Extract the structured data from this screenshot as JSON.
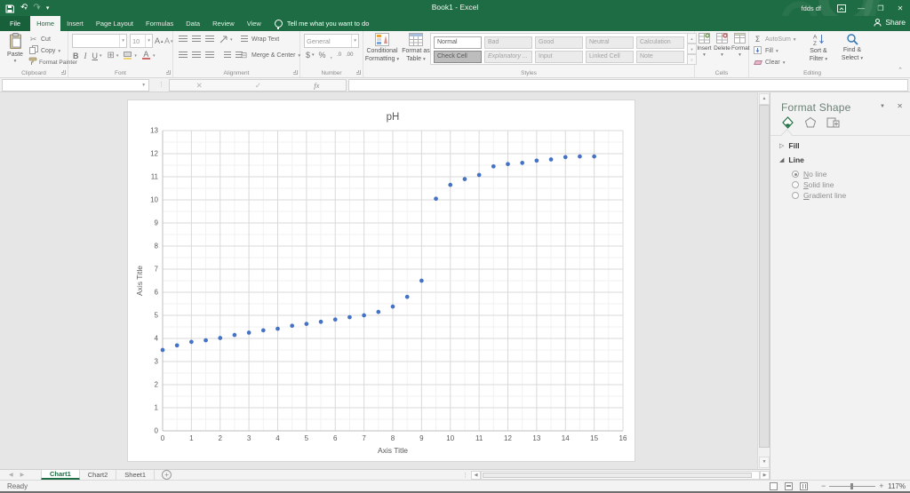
{
  "titlebar": {
    "title": "Book1 - Excel",
    "user": "fdds df"
  },
  "ribbon_tabs": [
    "File",
    "Home",
    "Insert",
    "Page Layout",
    "Formulas",
    "Data",
    "Review",
    "View"
  ],
  "active_tab": "Home",
  "tell_me": "Tell me what you want to do",
  "share_label": "Share",
  "ribbon": {
    "clipboard": {
      "label": "Clipboard",
      "paste": "Paste",
      "cut": "Cut",
      "copy": "Copy",
      "format_painter": "Format Painter"
    },
    "font": {
      "label": "Font",
      "size": "10",
      "bold": "B",
      "italic": "I",
      "underline": "U",
      "fontcolor": "A"
    },
    "alignment": {
      "label": "Alignment",
      "wrap": "Wrap Text",
      "merge": "Merge & Center"
    },
    "number": {
      "label": "Number",
      "format": "General",
      "currency": "$",
      "percent": "%",
      "comma": ",",
      "inc_dec": ".0",
      "dec_dec": ".00"
    },
    "styles": {
      "label": "Styles",
      "conditional": [
        "Conditional",
        "Formatting"
      ],
      "format_table": [
        "Format as",
        "Table"
      ],
      "cells": [
        {
          "label": "Normal",
          "variant": "normal"
        },
        {
          "label": "Bad",
          "variant": "disabled"
        },
        {
          "label": "Good",
          "variant": "disabled"
        },
        {
          "label": "Neutral",
          "variant": "disabled"
        },
        {
          "label": "Calculation",
          "variant": "disabled"
        },
        {
          "label": "Check Cell",
          "variant": "selected"
        },
        {
          "label": "Explanatory ...",
          "variant": "disabled italic"
        },
        {
          "label": "Input",
          "variant": "disabled"
        },
        {
          "label": "Linked Cell",
          "variant": "disabled"
        },
        {
          "label": "Note",
          "variant": "disabled"
        }
      ]
    },
    "cells": {
      "label": "Cells",
      "insert": "Insert",
      "delete": "Delete",
      "format": "Format"
    },
    "editing": {
      "label": "Editing",
      "autosum": "AutoSum",
      "fill": "Fill",
      "clear": "Clear",
      "sort_filter": [
        "Sort &",
        "Filter"
      ],
      "find_select": [
        "Find &",
        "Select"
      ]
    }
  },
  "formula_bar": {
    "name_box": "",
    "fx": "fx",
    "formula": ""
  },
  "chart_data": {
    "type": "scatter",
    "title": "pH",
    "xlabel": "Axis Title",
    "ylabel": "Axis Title",
    "xlim": [
      0,
      16
    ],
    "ylim": [
      0,
      13
    ],
    "x_major": 1,
    "y_major": 1,
    "x_minor": 0.5,
    "y_minor": 0.5,
    "marker_color": "#4472c4",
    "points": [
      [
        0,
        3.5
      ],
      [
        0.5,
        3.7
      ],
      [
        1,
        3.85
      ],
      [
        1.5,
        3.92
      ],
      [
        2,
        4.02
      ],
      [
        2.5,
        4.15
      ],
      [
        3,
        4.25
      ],
      [
        3.5,
        4.35
      ],
      [
        4,
        4.42
      ],
      [
        4.5,
        4.55
      ],
      [
        5,
        4.63
      ],
      [
        5.5,
        4.72
      ],
      [
        6,
        4.82
      ],
      [
        6.5,
        4.92
      ],
      [
        7,
        5.0
      ],
      [
        7.5,
        5.15
      ],
      [
        8,
        5.38
      ],
      [
        8.5,
        5.8
      ],
      [
        9,
        6.5
      ],
      [
        9.5,
        10.05
      ],
      [
        10,
        10.65
      ],
      [
        10.5,
        10.9
      ],
      [
        11,
        11.08
      ],
      [
        11.5,
        11.45
      ],
      [
        12,
        11.55
      ],
      [
        12.5,
        11.6
      ],
      [
        13,
        11.7
      ],
      [
        13.5,
        11.75
      ],
      [
        14,
        11.85
      ],
      [
        14.5,
        11.88
      ],
      [
        15,
        11.88
      ]
    ]
  },
  "pane": {
    "title": "Format Shape",
    "sections": [
      {
        "name": "Fill",
        "expanded": false
      },
      {
        "name": "Line",
        "expanded": true
      }
    ],
    "line_options": [
      "No line",
      "Solid line",
      "Gradient line"
    ],
    "selected_option": "No line"
  },
  "sheet_tabs": {
    "tabs": [
      "Chart1",
      "Chart2",
      "Sheet1"
    ],
    "active": "Chart1"
  },
  "status": {
    "ready": "Ready",
    "zoom": "117%"
  }
}
